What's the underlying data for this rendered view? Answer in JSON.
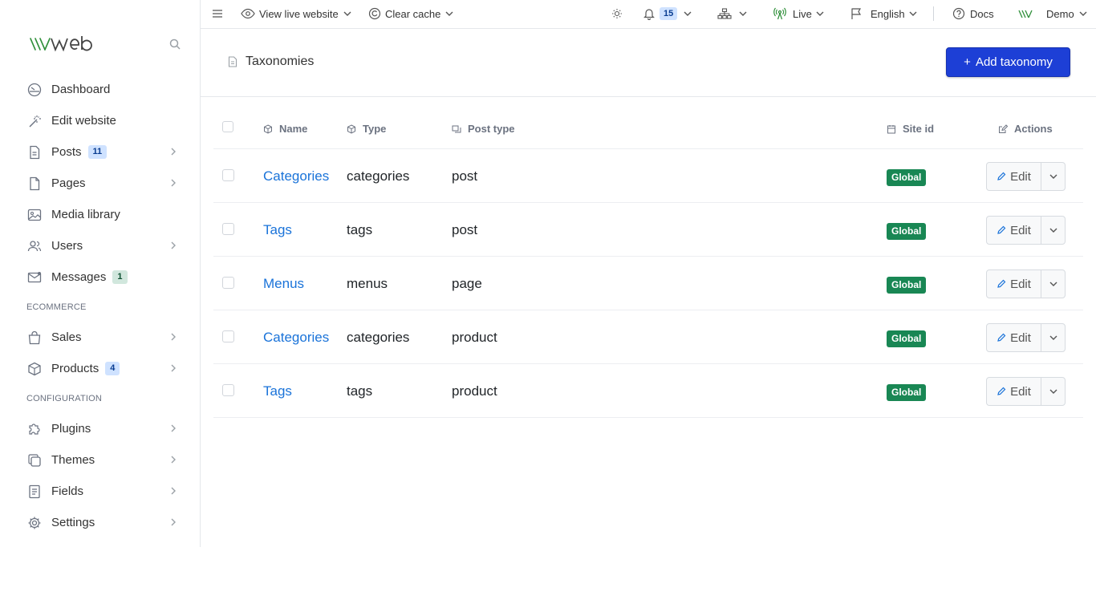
{
  "brand": {
    "logo": "\\\\\\web"
  },
  "sidebar": {
    "items": [
      {
        "label": "Dashboard"
      },
      {
        "label": "Edit website"
      },
      {
        "label": "Posts",
        "badge": "11"
      },
      {
        "label": "Pages"
      },
      {
        "label": "Media library"
      },
      {
        "label": "Users"
      },
      {
        "label": "Messages",
        "badge": "1"
      }
    ],
    "ecommerce_heading": "ECOMMERCE",
    "ecommerce_items": [
      {
        "label": "Sales"
      },
      {
        "label": "Products",
        "badge": "4"
      }
    ],
    "configuration_heading": "CONFIGURATION",
    "configuration_items": [
      {
        "label": "Plugins"
      },
      {
        "label": "Themes"
      },
      {
        "label": "Fields"
      },
      {
        "label": "Settings"
      }
    ]
  },
  "topbar": {
    "view_live": "View live website",
    "clear_cache": "Clear cache",
    "notifications_count": "15",
    "live": "Live",
    "language": "English",
    "docs": "Docs",
    "user": "Demo"
  },
  "page": {
    "title": "Taxonomies",
    "add_button": "Add taxonomy",
    "add_plus": "+"
  },
  "table": {
    "headers": {
      "name": "Name",
      "type": "Type",
      "post_type": "Post type",
      "site_id": "Site id",
      "actions": "Actions"
    },
    "rows": [
      {
        "name": "Categories",
        "type": "categories",
        "post_type": "post",
        "site": "Global",
        "edit": "Edit"
      },
      {
        "name": "Tags",
        "type": "tags",
        "post_type": "post",
        "site": "Global",
        "edit": "Edit"
      },
      {
        "name": "Menus",
        "type": "menus",
        "post_type": "page",
        "site": "Global",
        "edit": "Edit"
      },
      {
        "name": "Categories",
        "type": "categories",
        "post_type": "product",
        "site": "Global",
        "edit": "Edit"
      },
      {
        "name": "Tags",
        "type": "tags",
        "post_type": "product",
        "site": "Global",
        "edit": "Edit"
      }
    ]
  },
  "colors": {
    "primary": "#1d3fd6",
    "link": "#1a73d9",
    "success": "#198754",
    "brand_green": "#2f8f3a"
  }
}
